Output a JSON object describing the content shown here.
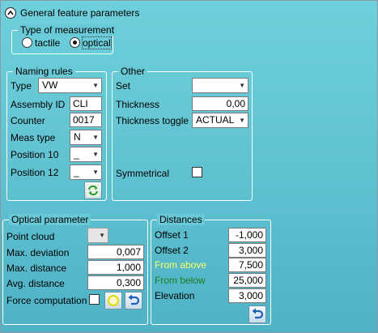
{
  "header": {
    "title": "General feature parameters"
  },
  "measurement": {
    "title": "Type of measurement",
    "options": [
      {
        "label": "tactile",
        "selected": false
      },
      {
        "label": "optical",
        "selected": true
      }
    ]
  },
  "naming_rules": {
    "title": "Naming rules",
    "type": {
      "label": "Type",
      "value": "VW"
    },
    "assembly_id": {
      "label": "Assembly ID",
      "value": "CLI"
    },
    "counter": {
      "label": "Counter",
      "value": "0017"
    },
    "meas_type": {
      "label": "Meas type",
      "value": "N"
    },
    "position_10": {
      "label": "Position 10",
      "value": "_"
    },
    "position_12": {
      "label": "Position 12",
      "value": "_"
    }
  },
  "other": {
    "title": "Other",
    "set": {
      "label": "Set",
      "value": ""
    },
    "thickness": {
      "label": "Thickness",
      "value": "0,00"
    },
    "thickness_toggle": {
      "label": "Thickness toggle",
      "value": "ACTUAL"
    },
    "symmetrical": {
      "label": "Symmetrical",
      "checked": false
    }
  },
  "optical": {
    "title": "Optical parameter",
    "point_cloud": {
      "label": "Point cloud",
      "value": ""
    },
    "max_deviation": {
      "label": "Max. deviation",
      "value": "0,007"
    },
    "max_distance": {
      "label": "Max. distance",
      "value": "1,000"
    },
    "avg_distance": {
      "label": "Avg. distance",
      "value": "0,300"
    },
    "force_computation": {
      "label": "Force computation",
      "checked": false
    }
  },
  "distances": {
    "title": "Distances",
    "offset1": {
      "label": "Offset 1",
      "value": "-1,000"
    },
    "offset2": {
      "label": "Offset 2",
      "value": "3,000"
    },
    "from_above": {
      "label": "From above",
      "value": "7,500",
      "color": "#ffff66"
    },
    "from_below": {
      "label": "From below",
      "value": "25,000",
      "color": "#1e7a1e"
    },
    "elevation": {
      "label": "Elevation",
      "value": "3,000"
    }
  },
  "icons": {
    "collapse": "chevron-up-icon",
    "refresh": "refresh-icon",
    "compute": "circle-compute-icon",
    "undo": "undo-icon"
  }
}
